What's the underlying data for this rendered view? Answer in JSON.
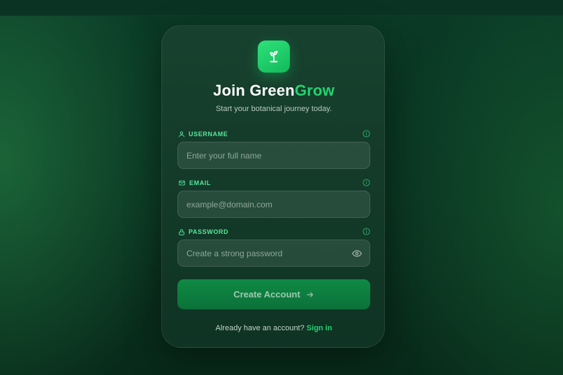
{
  "app": {
    "title_main": "Join Green",
    "title_accent": "Grow",
    "subtitle": "Start your botanical journey today."
  },
  "icons": {
    "logo": "sprout-icon",
    "username": "user-icon",
    "email": "mail-icon",
    "password": "lock-icon",
    "info": "info-icon",
    "toggle": "eye-icon",
    "submit": "arrow-right-icon"
  },
  "form": {
    "username": {
      "label": "USERNAME",
      "value": "",
      "placeholder": "Enter your full name"
    },
    "email": {
      "label": "EMAIL",
      "value": "",
      "placeholder": "example@domain.com"
    },
    "password": {
      "label": "PASSWORD",
      "value": "",
      "placeholder": "Create a strong password"
    },
    "submit_label": "Create Account"
  },
  "footer": {
    "prompt": "Already have an account?",
    "link": "Sign in"
  },
  "colors": {
    "accent": "#22d36f",
    "label": "#57e69a",
    "button": "#0f8a44",
    "background": "#0a3a26"
  }
}
